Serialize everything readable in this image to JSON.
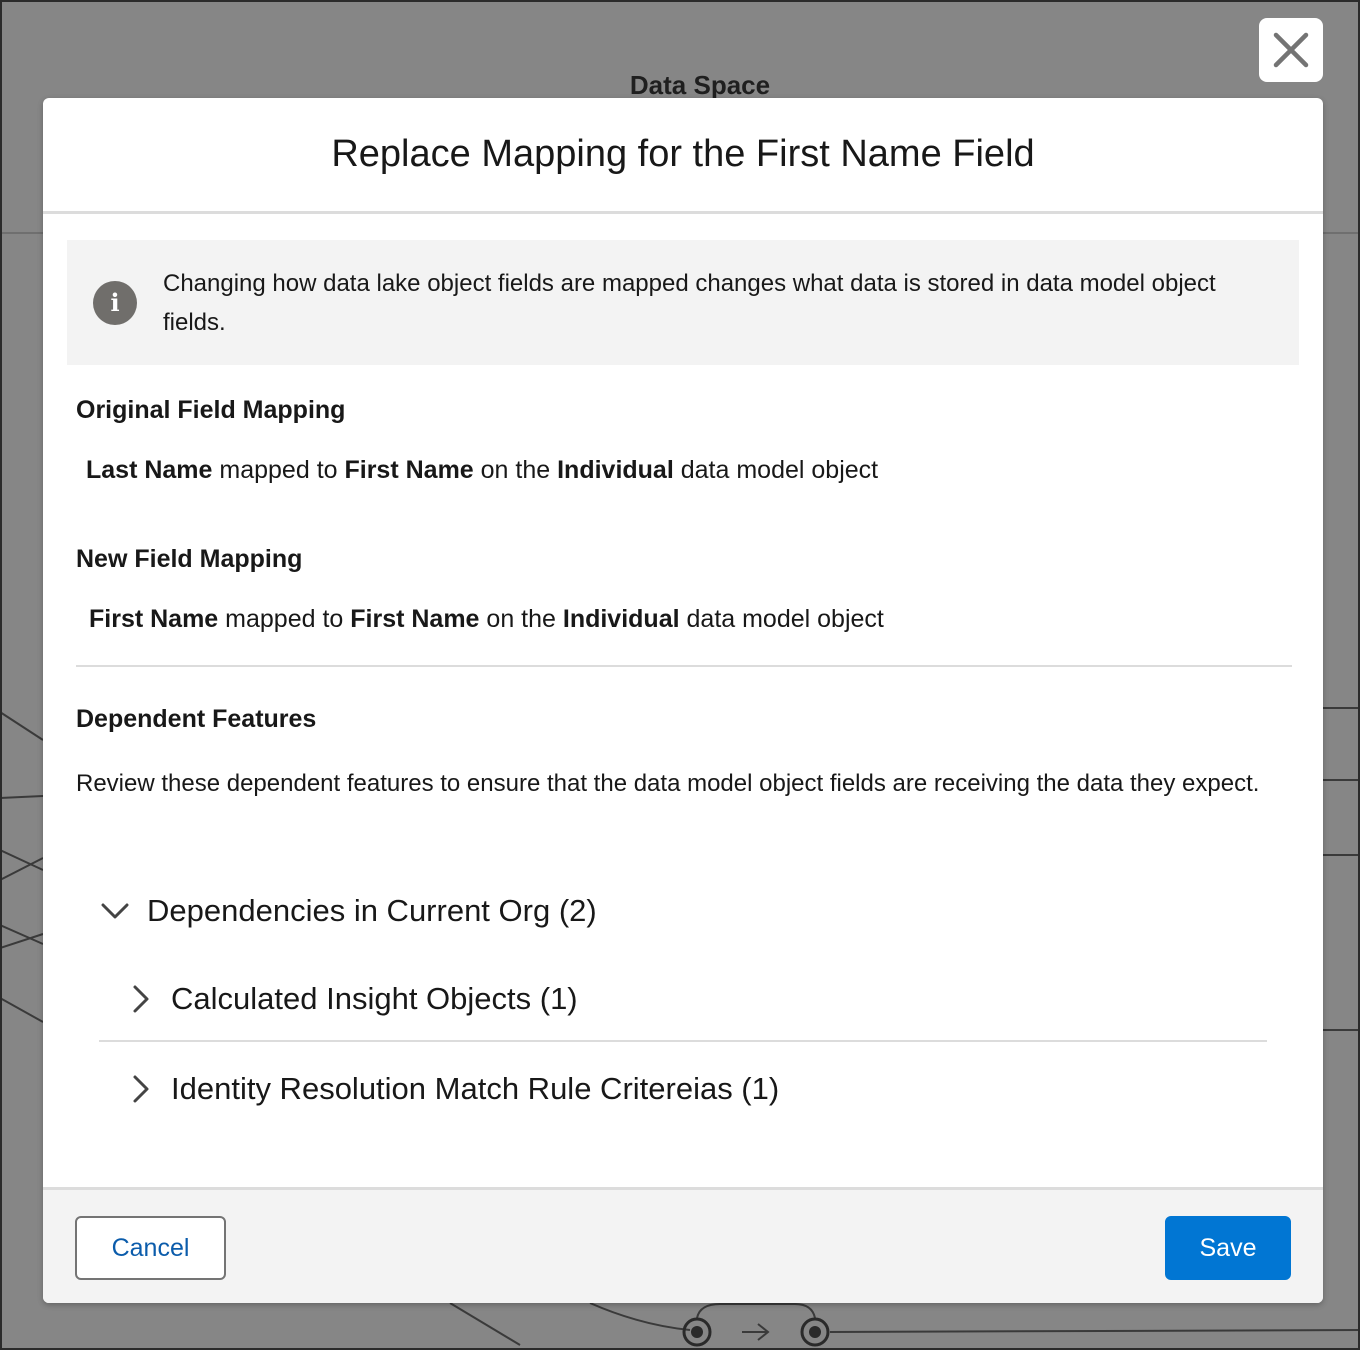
{
  "background": {
    "title": "Data Space"
  },
  "modal": {
    "title": "Replace Mapping for the First Name Field",
    "notice": "Changing how data lake object fields are mapped changes what data is stored in data model object fields.",
    "original": {
      "heading": "Original Field Mapping",
      "source": "Last Name",
      "connector1": " mapped to ",
      "target": "First Name",
      "connector2": " on the ",
      "object": "Individual",
      "suffix": " data model object"
    },
    "new": {
      "heading": "New Field Mapping",
      "source": "First Name",
      "connector1": " mapped to ",
      "target": "First Name",
      "connector2": " on the ",
      "object": "Individual",
      "suffix": " data model object"
    },
    "dependent": {
      "heading": "Dependent Features",
      "description": "Review these dependent features to ensure that the data model object fields are receiving the data they expect.",
      "group_label": "Dependencies in Current Org (2)",
      "items": [
        {
          "label": "Calculated Insight Objects (1)"
        },
        {
          "label": "Identity Resolution Match Rule Critereias (1)"
        }
      ]
    },
    "footer": {
      "cancel_label": "Cancel",
      "save_label": "Save"
    }
  },
  "colors": {
    "brand": "#0176d3",
    "link": "#0b5cab",
    "overlay": "#868686"
  }
}
